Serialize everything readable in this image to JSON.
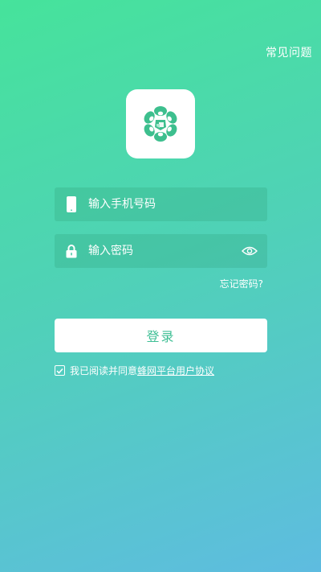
{
  "header": {
    "faq_label": "常见问题"
  },
  "logo": {
    "icon": "flower-logo-icon",
    "color": "#3dbf8e"
  },
  "login_form": {
    "phone_placeholder": "输入手机号码",
    "phone_value": "",
    "phone_icon": "phone-icon",
    "password_placeholder": "输入密码",
    "password_value": "",
    "password_icon": "lock-icon",
    "visibility_icon": "eye-icon",
    "forgot_password_label": "忘记密码?",
    "login_button_label": "登录"
  },
  "agreement": {
    "checked": true,
    "prefix_text": "我已阅读并同意",
    "link_text": "蜂网平台用户协议"
  },
  "colors": {
    "gradient_top": "#46e39b",
    "gradient_bottom": "#5ebce0",
    "accent": "#3fbf95"
  }
}
